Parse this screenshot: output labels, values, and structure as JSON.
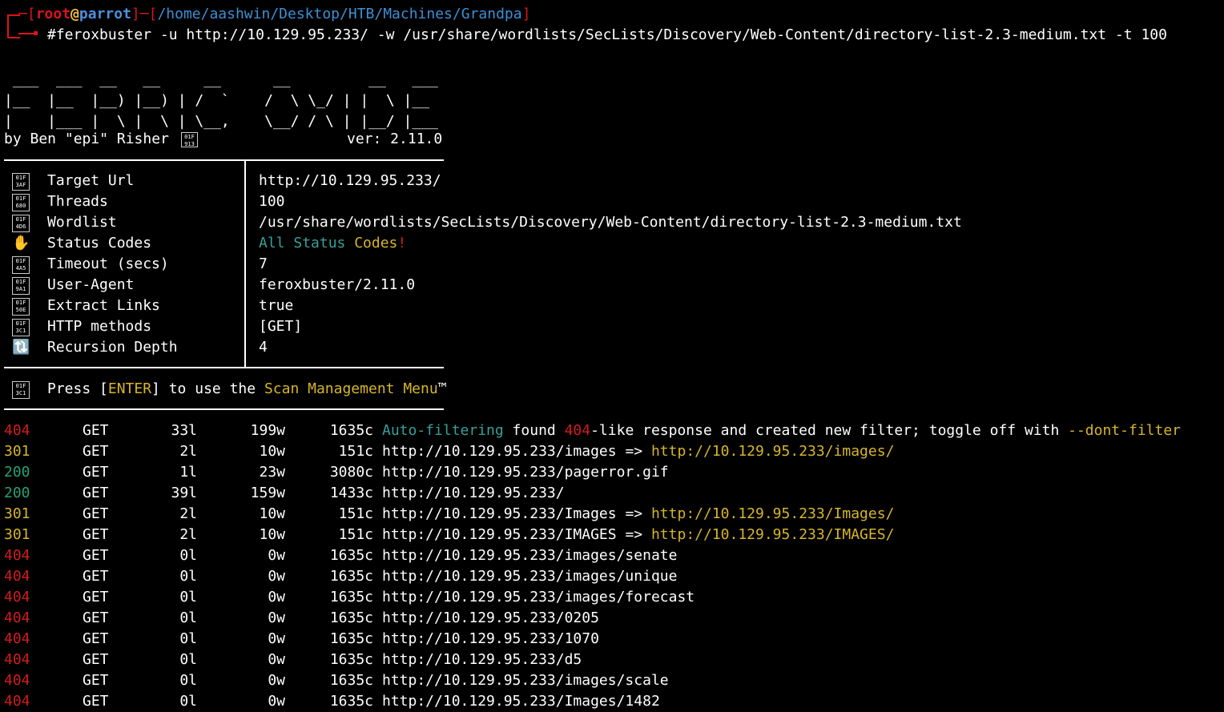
{
  "prompt": {
    "user": "root",
    "at": "@",
    "host": "parrot",
    "path": "/home/aashwin/Desktop/HTB/Machines/Grandpa",
    "hash": "#",
    "command": "feroxbuster -u http://10.129.95.233/ -w /usr/share/wordlists/SecLists/Discovery/Web-Content/directory-list-2.3-medium.txt -t 100"
  },
  "banner": {
    "art": [
      " ___  ___  __   __     __      __         __   ___",
      "|__  |__  |__) |__) | /  `    /  \\ \\_/ | |  \\ |__",
      "|    |___ |  \\ |  \\ | \\__,    \\__/ / \\ | |__/ |___"
    ],
    "byline": "by Ben \"epi\" Risher ",
    "byline_icon": "01F\n913",
    "version": "ver: 2.11.0"
  },
  "config": [
    {
      "icon": "01F\n3AF",
      "label": "Target Url",
      "value": "http://10.129.95.233/"
    },
    {
      "icon": "01F\n680",
      "label": "Threads",
      "value": "100"
    },
    {
      "icon": "01F\n4D6",
      "label": "Wordlist",
      "value": "/usr/share/wordlists/SecLists/Discovery/Web-Content/directory-list-2.3-medium.txt"
    },
    {
      "icon": "✋",
      "label": "Status Codes",
      "value_parts": [
        "All",
        " Status",
        " Codes",
        "!"
      ]
    },
    {
      "icon": "01F\n4A5",
      "label": "Timeout (secs)",
      "value": "7"
    },
    {
      "icon": "01F\n9A1",
      "label": "User-Agent",
      "value": "feroxbuster/2.11.0"
    },
    {
      "icon": "01F\n50E",
      "label": "Extract Links",
      "value": "true"
    },
    {
      "icon": "01F\n3C1",
      "label": "HTTP methods",
      "value": "[GET]"
    },
    {
      "icon": "🔃",
      "label": "Recursion Depth",
      "value": "4"
    }
  ],
  "menu_hint": {
    "icon": "01F\n3C1",
    "press": "Press [",
    "enter": "ENTER",
    "middle": "] to use the ",
    "menu": "Scan Management Menu",
    "tm": "™"
  },
  "results": [
    {
      "status": "404",
      "method": "GET",
      "lines": "33l",
      "words": "199w",
      "chars": "1635c",
      "url": "",
      "note_parts": [
        "Auto-filtering",
        " found ",
        "404",
        "-like response and created new filter; toggle off with ",
        "--dont-filter"
      ]
    },
    {
      "status": "301",
      "method": "GET",
      "lines": "2l",
      "words": "10w",
      "chars": "151c",
      "url": "http://10.129.95.233/images",
      "redirect": "http://10.129.95.233/images/"
    },
    {
      "status": "200",
      "method": "GET",
      "lines": "1l",
      "words": "23w",
      "chars": "3080c",
      "url": "http://10.129.95.233/pagerror.gif"
    },
    {
      "status": "200",
      "method": "GET",
      "lines": "39l",
      "words": "159w",
      "chars": "1433c",
      "url": "http://10.129.95.233/"
    },
    {
      "status": "301",
      "method": "GET",
      "lines": "2l",
      "words": "10w",
      "chars": "151c",
      "url": "http://10.129.95.233/Images",
      "redirect": "http://10.129.95.233/Images/"
    },
    {
      "status": "301",
      "method": "GET",
      "lines": "2l",
      "words": "10w",
      "chars": "151c",
      "url": "http://10.129.95.233/IMAGES",
      "redirect": "http://10.129.95.233/IMAGES/"
    },
    {
      "status": "404",
      "method": "GET",
      "lines": "0l",
      "words": "0w",
      "chars": "1635c",
      "url": "http://10.129.95.233/images/senate"
    },
    {
      "status": "404",
      "method": "GET",
      "lines": "0l",
      "words": "0w",
      "chars": "1635c",
      "url": "http://10.129.95.233/images/unique"
    },
    {
      "status": "404",
      "method": "GET",
      "lines": "0l",
      "words": "0w",
      "chars": "1635c",
      "url": "http://10.129.95.233/images/forecast"
    },
    {
      "status": "404",
      "method": "GET",
      "lines": "0l",
      "words": "0w",
      "chars": "1635c",
      "url": "http://10.129.95.233/0205"
    },
    {
      "status": "404",
      "method": "GET",
      "lines": "0l",
      "words": "0w",
      "chars": "1635c",
      "url": "http://10.129.95.233/1070"
    },
    {
      "status": "404",
      "method": "GET",
      "lines": "0l",
      "words": "0w",
      "chars": "1635c",
      "url": "http://10.129.95.233/d5"
    },
    {
      "status": "404",
      "method": "GET",
      "lines": "0l",
      "words": "0w",
      "chars": "1635c",
      "url": "http://10.129.95.233/images/scale"
    },
    {
      "status": "404",
      "method": "GET",
      "lines": "0l",
      "words": "0w",
      "chars": "1635c",
      "url": "http://10.129.95.233/Images/1482"
    }
  ],
  "redirect_arrow": " => ",
  "colors": {
    "background": "#000000",
    "status_200": "#28a07a",
    "status_301": "#d7b52b",
    "status_404": "#d31c1c",
    "prompt_red": "#d9141d"
  }
}
